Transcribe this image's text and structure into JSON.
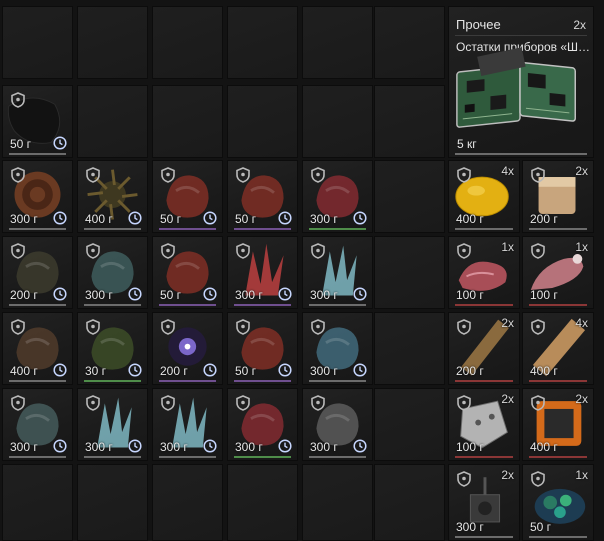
{
  "inventory": {
    "large_item": {
      "category": "Прочее",
      "name": "Остатки приборов «Ше...",
      "count": "2x",
      "price": "5 кг",
      "icon": "circuit-boards-icon"
    },
    "items": [
      {
        "id": "r1c1",
        "price": "50 г",
        "count": "",
        "icon": "black-artifact-icon",
        "color": "#121212",
        "bar": "gray"
      },
      {
        "id": "r2c1",
        "price": "300 г",
        "count": "",
        "icon": "coiled-artifact-icon",
        "color": "#6a3a22",
        "bar": "gray"
      },
      {
        "id": "r2c2",
        "price": "400 г",
        "count": "",
        "icon": "spiky-artifact-icon",
        "color": "#3e3820",
        "bar": "gray"
      },
      {
        "id": "r2c3",
        "price": "50 г",
        "count": "",
        "icon": "red-flesh-artifact-icon",
        "color": "#7a2e25",
        "bar": "purple"
      },
      {
        "id": "r2c4",
        "price": "50 г",
        "count": "",
        "icon": "red-flesh-artifact-icon",
        "color": "#7a2e25",
        "bar": "purple"
      },
      {
        "id": "r2c5",
        "price": "300 г",
        "count": "",
        "icon": "red-crystal-artifact-icon",
        "color": "#7d2a30",
        "bar": "green"
      },
      {
        "id": "r2c7",
        "price": "400 г",
        "count": "4x",
        "icon": "lemon-icon",
        "color": "#e3b012",
        "bar": "gray"
      },
      {
        "id": "r2c8",
        "price": "200 г",
        "count": "2x",
        "icon": "bread-loaf-icon",
        "color": "#c8a57d",
        "bar": "gray"
      },
      {
        "id": "r3c1",
        "price": "200 г",
        "count": "",
        "icon": "dark-rock-artifact-icon",
        "color": "#3b3a2c",
        "bar": "gray"
      },
      {
        "id": "r3c2",
        "price": "300 г",
        "count": "",
        "icon": "blue-rock-artifact-icon",
        "color": "#3d5a5a",
        "bar": "gray"
      },
      {
        "id": "r3c3",
        "price": "50 г",
        "count": "",
        "icon": "red-flesh-artifact-icon",
        "color": "#7a2e25",
        "bar": "purple"
      },
      {
        "id": "r3c4",
        "price": "300 г",
        "count": "",
        "icon": "red-spikes-artifact-icon",
        "color": "#a33a3a",
        "bar": "purple"
      },
      {
        "id": "r3c5",
        "price": "300 г",
        "count": "",
        "icon": "ice-crystal-artifact-icon",
        "color": "#7fb8c3",
        "bar": "gray"
      },
      {
        "id": "r3c7",
        "price": "100 г",
        "count": "1x",
        "icon": "raw-meat-icon",
        "color": "#a84e57",
        "bar": "red"
      },
      {
        "id": "r3c8",
        "price": "100 г",
        "count": "1x",
        "icon": "meat-leg-icon",
        "color": "#b6727a",
        "bar": "red"
      },
      {
        "id": "r4c1",
        "price": "400 г",
        "count": "",
        "icon": "brown-spore-artifact-icon",
        "color": "#4e3a2a",
        "bar": "gray"
      },
      {
        "id": "r4c2",
        "price": "30 г",
        "count": "",
        "icon": "green-moss-artifact-icon",
        "color": "#3b4a27",
        "bar": "green"
      },
      {
        "id": "r4c3",
        "price": "200 г",
        "count": "",
        "icon": "glowing-orb-artifact-icon",
        "color": "#7b67c9",
        "bar": "purple"
      },
      {
        "id": "r4c4",
        "price": "50 г",
        "count": "",
        "icon": "red-flesh-artifact-icon",
        "color": "#7a2e25",
        "bar": "purple"
      },
      {
        "id": "r4c5",
        "price": "300 г",
        "count": "",
        "icon": "blue-stone-artifact-icon",
        "color": "#3f6677",
        "bar": "gray"
      },
      {
        "id": "r4c7",
        "price": "200 г",
        "count": "2x",
        "icon": "wood-plank-icon",
        "color": "#8a6a3e",
        "bar": "red"
      },
      {
        "id": "r4c8",
        "price": "400 г",
        "count": "4x",
        "icon": "wood-board-icon",
        "color": "#b88c5a",
        "bar": "red"
      },
      {
        "id": "r5c1",
        "price": "300 г",
        "count": "",
        "icon": "blue-rock-artifact-icon",
        "color": "#435858",
        "bar": "gray"
      },
      {
        "id": "r5c2",
        "price": "300 г",
        "count": "",
        "icon": "ice-crystal-artifact-icon",
        "color": "#7fb8c3",
        "bar": "gray"
      },
      {
        "id": "r5c3",
        "price": "300 г",
        "count": "",
        "icon": "ice-crystal-artifact-icon",
        "color": "#7fb8c3",
        "bar": "gray"
      },
      {
        "id": "r5c4",
        "price": "300 г",
        "count": "",
        "icon": "red-crystal-artifact-icon",
        "color": "#7d2a30",
        "bar": "green"
      },
      {
        "id": "r5c5",
        "price": "300 г",
        "count": "",
        "icon": "grey-rose-artifact-icon",
        "color": "#585858",
        "bar": "gray"
      },
      {
        "id": "r5c7",
        "price": "100 г",
        "count": "2x",
        "icon": "metal-scrap-icon",
        "color": "#b3b3b3",
        "bar": "red"
      },
      {
        "id": "r5c8",
        "price": "400 г",
        "count": "2x",
        "icon": "orange-device-icon",
        "color": "#d46a1a",
        "bar": "red"
      },
      {
        "id": "r6c7",
        "price": "300 г",
        "count": "2x",
        "icon": "mechanical-part-icon",
        "color": "#3a3a3a",
        "bar": "gray"
      },
      {
        "id": "r6c8",
        "price": "50 г",
        "count": "1x",
        "icon": "green-crystals-icon",
        "color": "#2a7a62",
        "bar": "gray"
      }
    ]
  },
  "colors": {
    "background": "#131313",
    "cell": "#1e1e1e",
    "text": "#e6e6e6",
    "icon_gray": "#b9b9b9",
    "clock_blue": "#c7d7ff"
  }
}
